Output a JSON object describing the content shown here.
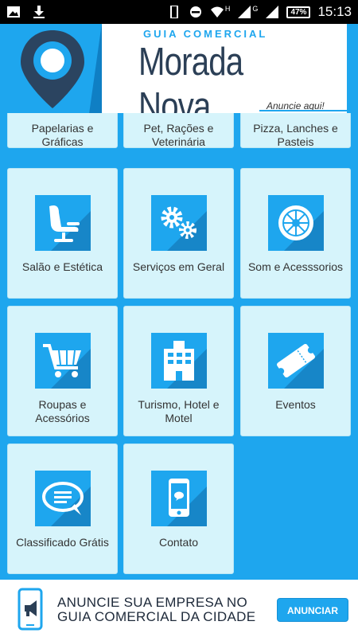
{
  "status_bar": {
    "battery": "47%",
    "time": "15:13",
    "network_1": "H",
    "network_2": "G"
  },
  "header": {
    "subtitle": "Guia Comercial",
    "title": "Morada Nova",
    "cta": "Anuncie aqui!",
    "brand_color": "#1ea6ee",
    "title_color": "#2b3f56"
  },
  "categories": [
    {
      "label": "Papelarias e Gráficas",
      "icon": "stationery-icon"
    },
    {
      "label": "Pet, Rações e Veterinária",
      "icon": "pet-icon"
    },
    {
      "label": "Pizza, Lanches e Pasteis",
      "icon": "pizza-icon"
    },
    {
      "label": "Salão e Estética",
      "icon": "salon-chair-icon"
    },
    {
      "label": "Serviços em Geral",
      "icon": "gears-icon"
    },
    {
      "label": "Som e Acesssorios",
      "icon": "speaker-icon"
    },
    {
      "label": "Roupas e Acessórios",
      "icon": "shopping-cart-icon"
    },
    {
      "label": "Turismo, Hotel e Motel",
      "icon": "hotel-icon"
    },
    {
      "label": "Eventos",
      "icon": "ticket-icon"
    },
    {
      "label": "Classificado Grátis",
      "icon": "chat-bubble-icon"
    },
    {
      "label": "Contato",
      "icon": "smartphone-icon"
    }
  ],
  "ad_banner": {
    "text_line1": "ANUNCIE SUA EMPRESA NO",
    "text_line2": "GUIA COMERCIAL DA CIDADE",
    "button": "ANUNCIAR"
  }
}
